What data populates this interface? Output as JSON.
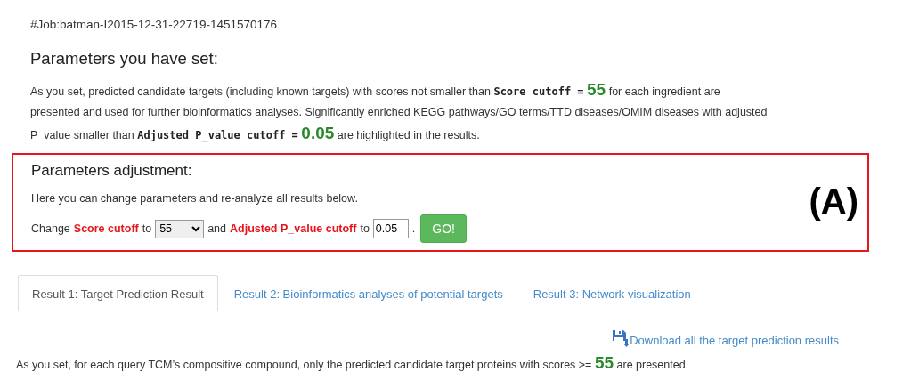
{
  "job_id": "#Job:batman-I2015-12-31-22719-1451570176",
  "parameters_set": {
    "heading": "Parameters you have set:",
    "paragraph": [
      {
        "kind": "text",
        "text": "As you set, predicted candidate targets (including known targets) with scores not smaller than "
      },
      {
        "kind": "label",
        "text": "Score cutoff ="
      },
      {
        "kind": "value",
        "text": "55"
      },
      {
        "kind": "text",
        "text": " for each ingredient are presented and used for further bioinformatics analyses. Significantly enriched KEGG pathways/GO terms/TTD diseases/OMIM diseases with adjusted P_value smaller than "
      },
      {
        "kind": "label",
        "text": "Adjusted P_value cutoff ="
      },
      {
        "kind": "value",
        "text": "0.05"
      },
      {
        "kind": "text",
        "text": " are highlighted in the results."
      }
    ]
  },
  "adjustment": {
    "heading": "Parameters adjustment:",
    "note": "Here you can change parameters and re-analyze all results below.",
    "controls": [
      {
        "kind": "text",
        "text": "Change"
      },
      {
        "kind": "param",
        "text": "Score cutoff"
      },
      {
        "kind": "text",
        "text": "to"
      },
      {
        "kind": "select",
        "value": "55"
      },
      {
        "kind": "text",
        "text": "and"
      },
      {
        "kind": "param",
        "text": "Adjusted P_value cutoff"
      },
      {
        "kind": "text",
        "text": "to"
      },
      {
        "kind": "input",
        "value": "0.05"
      },
      {
        "kind": "text",
        "text": "."
      },
      {
        "kind": "button",
        "text": "GO!"
      }
    ],
    "annotation": "(A)"
  },
  "tabs": [
    {
      "label": "Result 1: Target Prediction Result",
      "selected": true
    },
    {
      "label": "Result 2: Bioinformatics analyses of potential targets",
      "selected": false
    },
    {
      "label": "Result 3: Network visualization",
      "selected": false
    }
  ],
  "download_link": "Download all the target prediction results",
  "result_note": [
    {
      "kind": "text",
      "text": "As you set, for each query TCM’s compositive compound, only the predicted candidate target proteins with scores >= "
    },
    {
      "kind": "value",
      "text": "55"
    },
    {
      "kind": "text",
      "text": " are presented."
    }
  ]
}
